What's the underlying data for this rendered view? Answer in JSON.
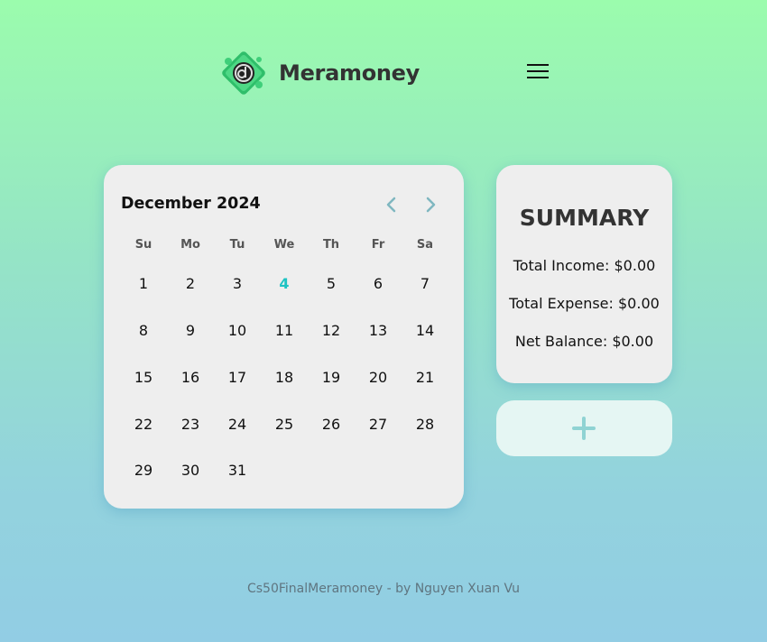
{
  "header": {
    "app_name": "Meramoney",
    "logo_icon": "meramoney-logo",
    "menu_icon": "hamburger-menu-icon"
  },
  "calendar": {
    "title": "December 2024",
    "weekdays": [
      "Su",
      "Mo",
      "Tu",
      "We",
      "Th",
      "Fr",
      "Sa"
    ],
    "first_weekday_index": 0,
    "days_in_month": 31,
    "today": 4,
    "today_color": "#1ec3c3",
    "nav_color": "#7fb7c0"
  },
  "summary": {
    "title": "SUMMARY",
    "total_income": "Total Income: $0.00",
    "total_expense": "Total Expense: $0.00",
    "net_balance": "Net Balance: $0.00"
  },
  "add_button": {
    "icon": "plus-icon",
    "color": "#8fd3d3"
  },
  "footer": {
    "text": "Cs50FinalMeramoney - by Nguyen Xuan Vu"
  }
}
